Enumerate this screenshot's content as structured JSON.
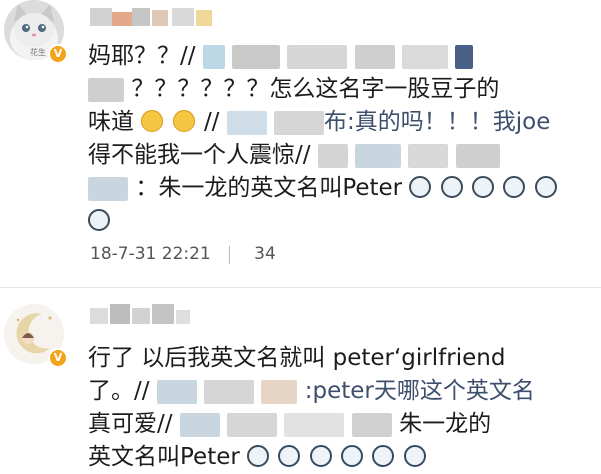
{
  "comments": [
    {
      "avatar_caption": "花生",
      "lines": [
        {
          "pre": "妈耶？？//",
          "post": ""
        },
        {
          "pre": "",
          "post": "？？？？？？怎么这名字一股豆子的"
        },
        {
          "pre": "味道",
          "post": "//"
        },
        {
          "pre": "",
          "post": "布:真的吗！！！我joe"
        },
        {
          "pre": "得不能我一个人震惊//",
          "post": ""
        },
        {
          "pre": "",
          "post": "：朱一龙的英文名叫Peter"
        }
      ],
      "timestamp": "18-7-31 22:21",
      "count": "34"
    },
    {
      "lines": [
        {
          "pre": "行了 以后我英文名就叫 peter‘girlfriend",
          "post": ""
        },
        {
          "pre": "了。//",
          "post": ":peter天哪这个英文名"
        },
        {
          "pre": "真可爱//",
          "post": "朱一龙的"
        },
        {
          "pre": "英文名叫Peter",
          "post": ""
        }
      ]
    }
  ]
}
